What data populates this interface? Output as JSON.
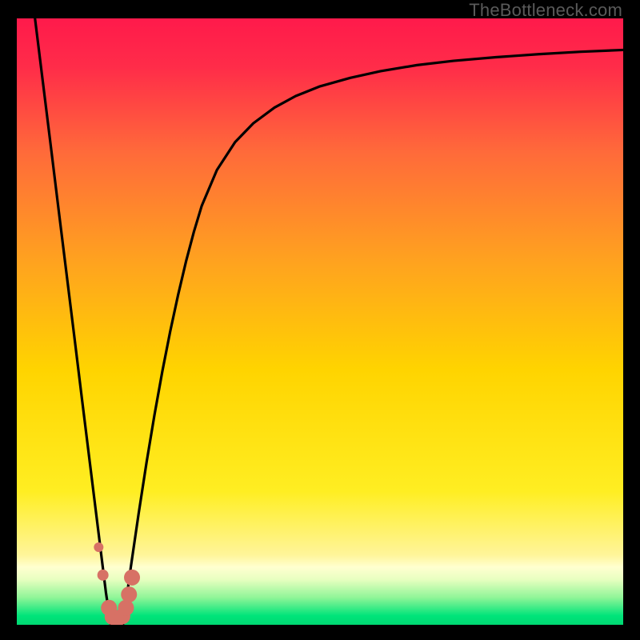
{
  "watermark": "TheBottleneck.com",
  "chart_data": {
    "type": "line",
    "title": "",
    "xlabel": "",
    "ylabel": "",
    "xlim": [
      0,
      100
    ],
    "ylim": [
      0,
      100
    ],
    "grid": false,
    "legend": false,
    "gradient_colors": {
      "top": "#ff1a4b",
      "yellow": "#ffe600",
      "pale_yellow": "#ffffb0",
      "green": "#00e47a"
    },
    "series": [
      {
        "name": "left-curve",
        "x": [
          3.0,
          4.3,
          5.6,
          6.9,
          8.2,
          9.5,
          10.8,
          12.1,
          13.4,
          14.7,
          15.5
        ],
        "y": [
          100,
          89.5,
          79.0,
          68.4,
          57.9,
          47.4,
          36.8,
          26.3,
          15.8,
          5.3,
          0.0
        ]
      },
      {
        "name": "right-curve",
        "x": [
          17.5,
          18.8,
          20.1,
          21.4,
          22.7,
          24.0,
          25.3,
          26.6,
          27.9,
          29.2,
          30.5,
          33.0,
          36.0,
          39.0,
          42.5,
          46.0,
          50.0,
          55.0,
          60.0,
          66.0,
          72.0,
          79.0,
          86.0,
          93.0,
          100.0
        ],
        "y": [
          0.0,
          9.5,
          18.4,
          26.8,
          34.6,
          41.8,
          48.4,
          54.4,
          59.9,
          64.8,
          69.1,
          75.0,
          79.6,
          82.7,
          85.3,
          87.2,
          88.8,
          90.2,
          91.3,
          92.3,
          93.0,
          93.6,
          94.1,
          94.5,
          94.8
        ]
      }
    ],
    "markers": [
      {
        "x": 13.5,
        "y": 12.8,
        "r": 6,
        "color": "#d77165"
      },
      {
        "x": 14.2,
        "y": 8.2,
        "r": 7,
        "color": "#d77165"
      },
      {
        "x": 15.2,
        "y": 2.8,
        "r": 10,
        "color": "#d77165"
      },
      {
        "x": 15.8,
        "y": 1.3,
        "r": 10,
        "color": "#d77165"
      },
      {
        "x": 16.6,
        "y": 1.0,
        "r": 10,
        "color": "#d77165"
      },
      {
        "x": 17.4,
        "y": 1.4,
        "r": 10,
        "color": "#d77165"
      },
      {
        "x": 18.0,
        "y": 2.8,
        "r": 10,
        "color": "#d77165"
      },
      {
        "x": 18.5,
        "y": 5.0,
        "r": 10,
        "color": "#d77165"
      },
      {
        "x": 19.0,
        "y": 7.8,
        "r": 10,
        "color": "#d77165"
      }
    ]
  }
}
